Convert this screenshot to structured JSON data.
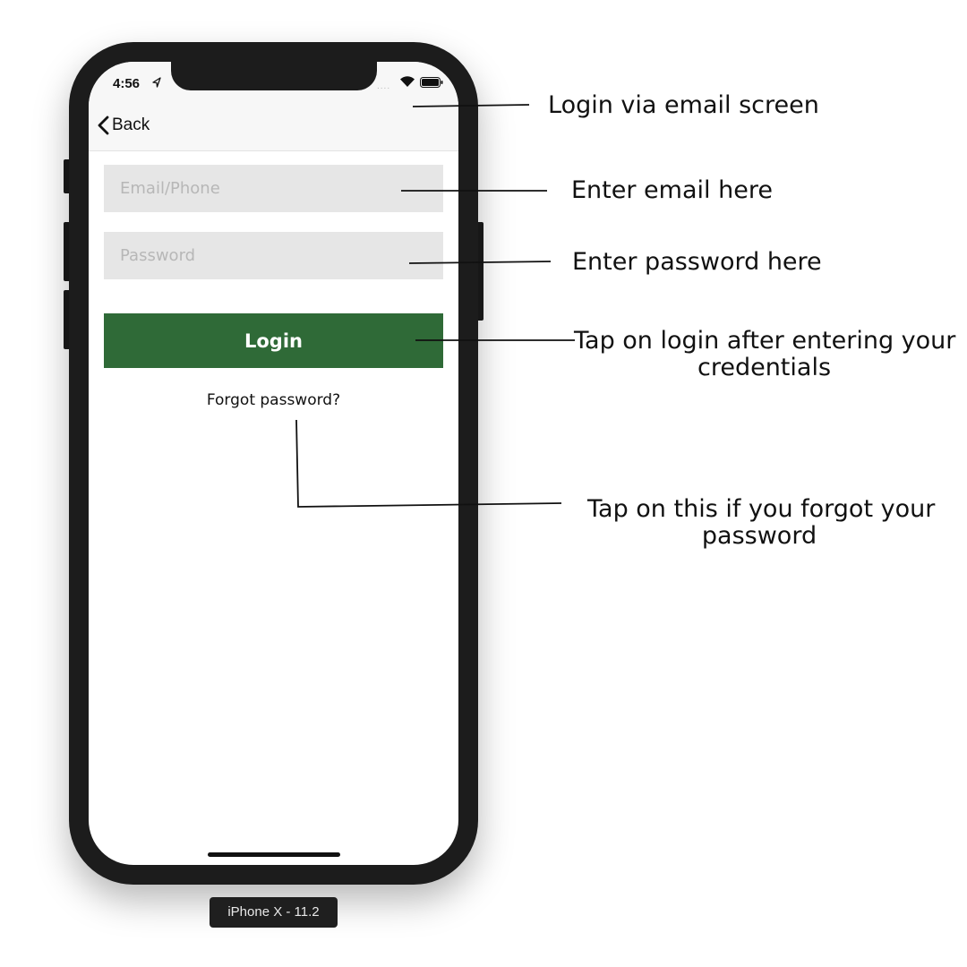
{
  "status_bar": {
    "time": "4:56",
    "signal_dots": "....",
    "location_icon": "location-arrow-icon",
    "wifi_icon": "wifi-icon",
    "battery_icon": "battery-icon"
  },
  "nav": {
    "back_label": "Back",
    "back_icon": "chevron-left-icon"
  },
  "form": {
    "email_placeholder": "Email/Phone",
    "email_value": "",
    "password_placeholder": "Password",
    "password_value": "",
    "login_label": "Login",
    "forgot_label": "Forgot password?"
  },
  "device": {
    "label": "iPhone X - 11.2"
  },
  "annotations": {
    "screen": "Login via email screen",
    "email": "Enter email here",
    "password": "Enter password here",
    "login_line1": "Tap on login after entering your",
    "login_line2": "credentials",
    "forgot_line1": "Tap on this if you forgot your",
    "forgot_line2": "password"
  },
  "colors": {
    "login_button": "#2f6a37",
    "input_background": "#e6e6e6",
    "nav_background": "#f7f7f7",
    "device_frame": "#1c1c1c"
  }
}
